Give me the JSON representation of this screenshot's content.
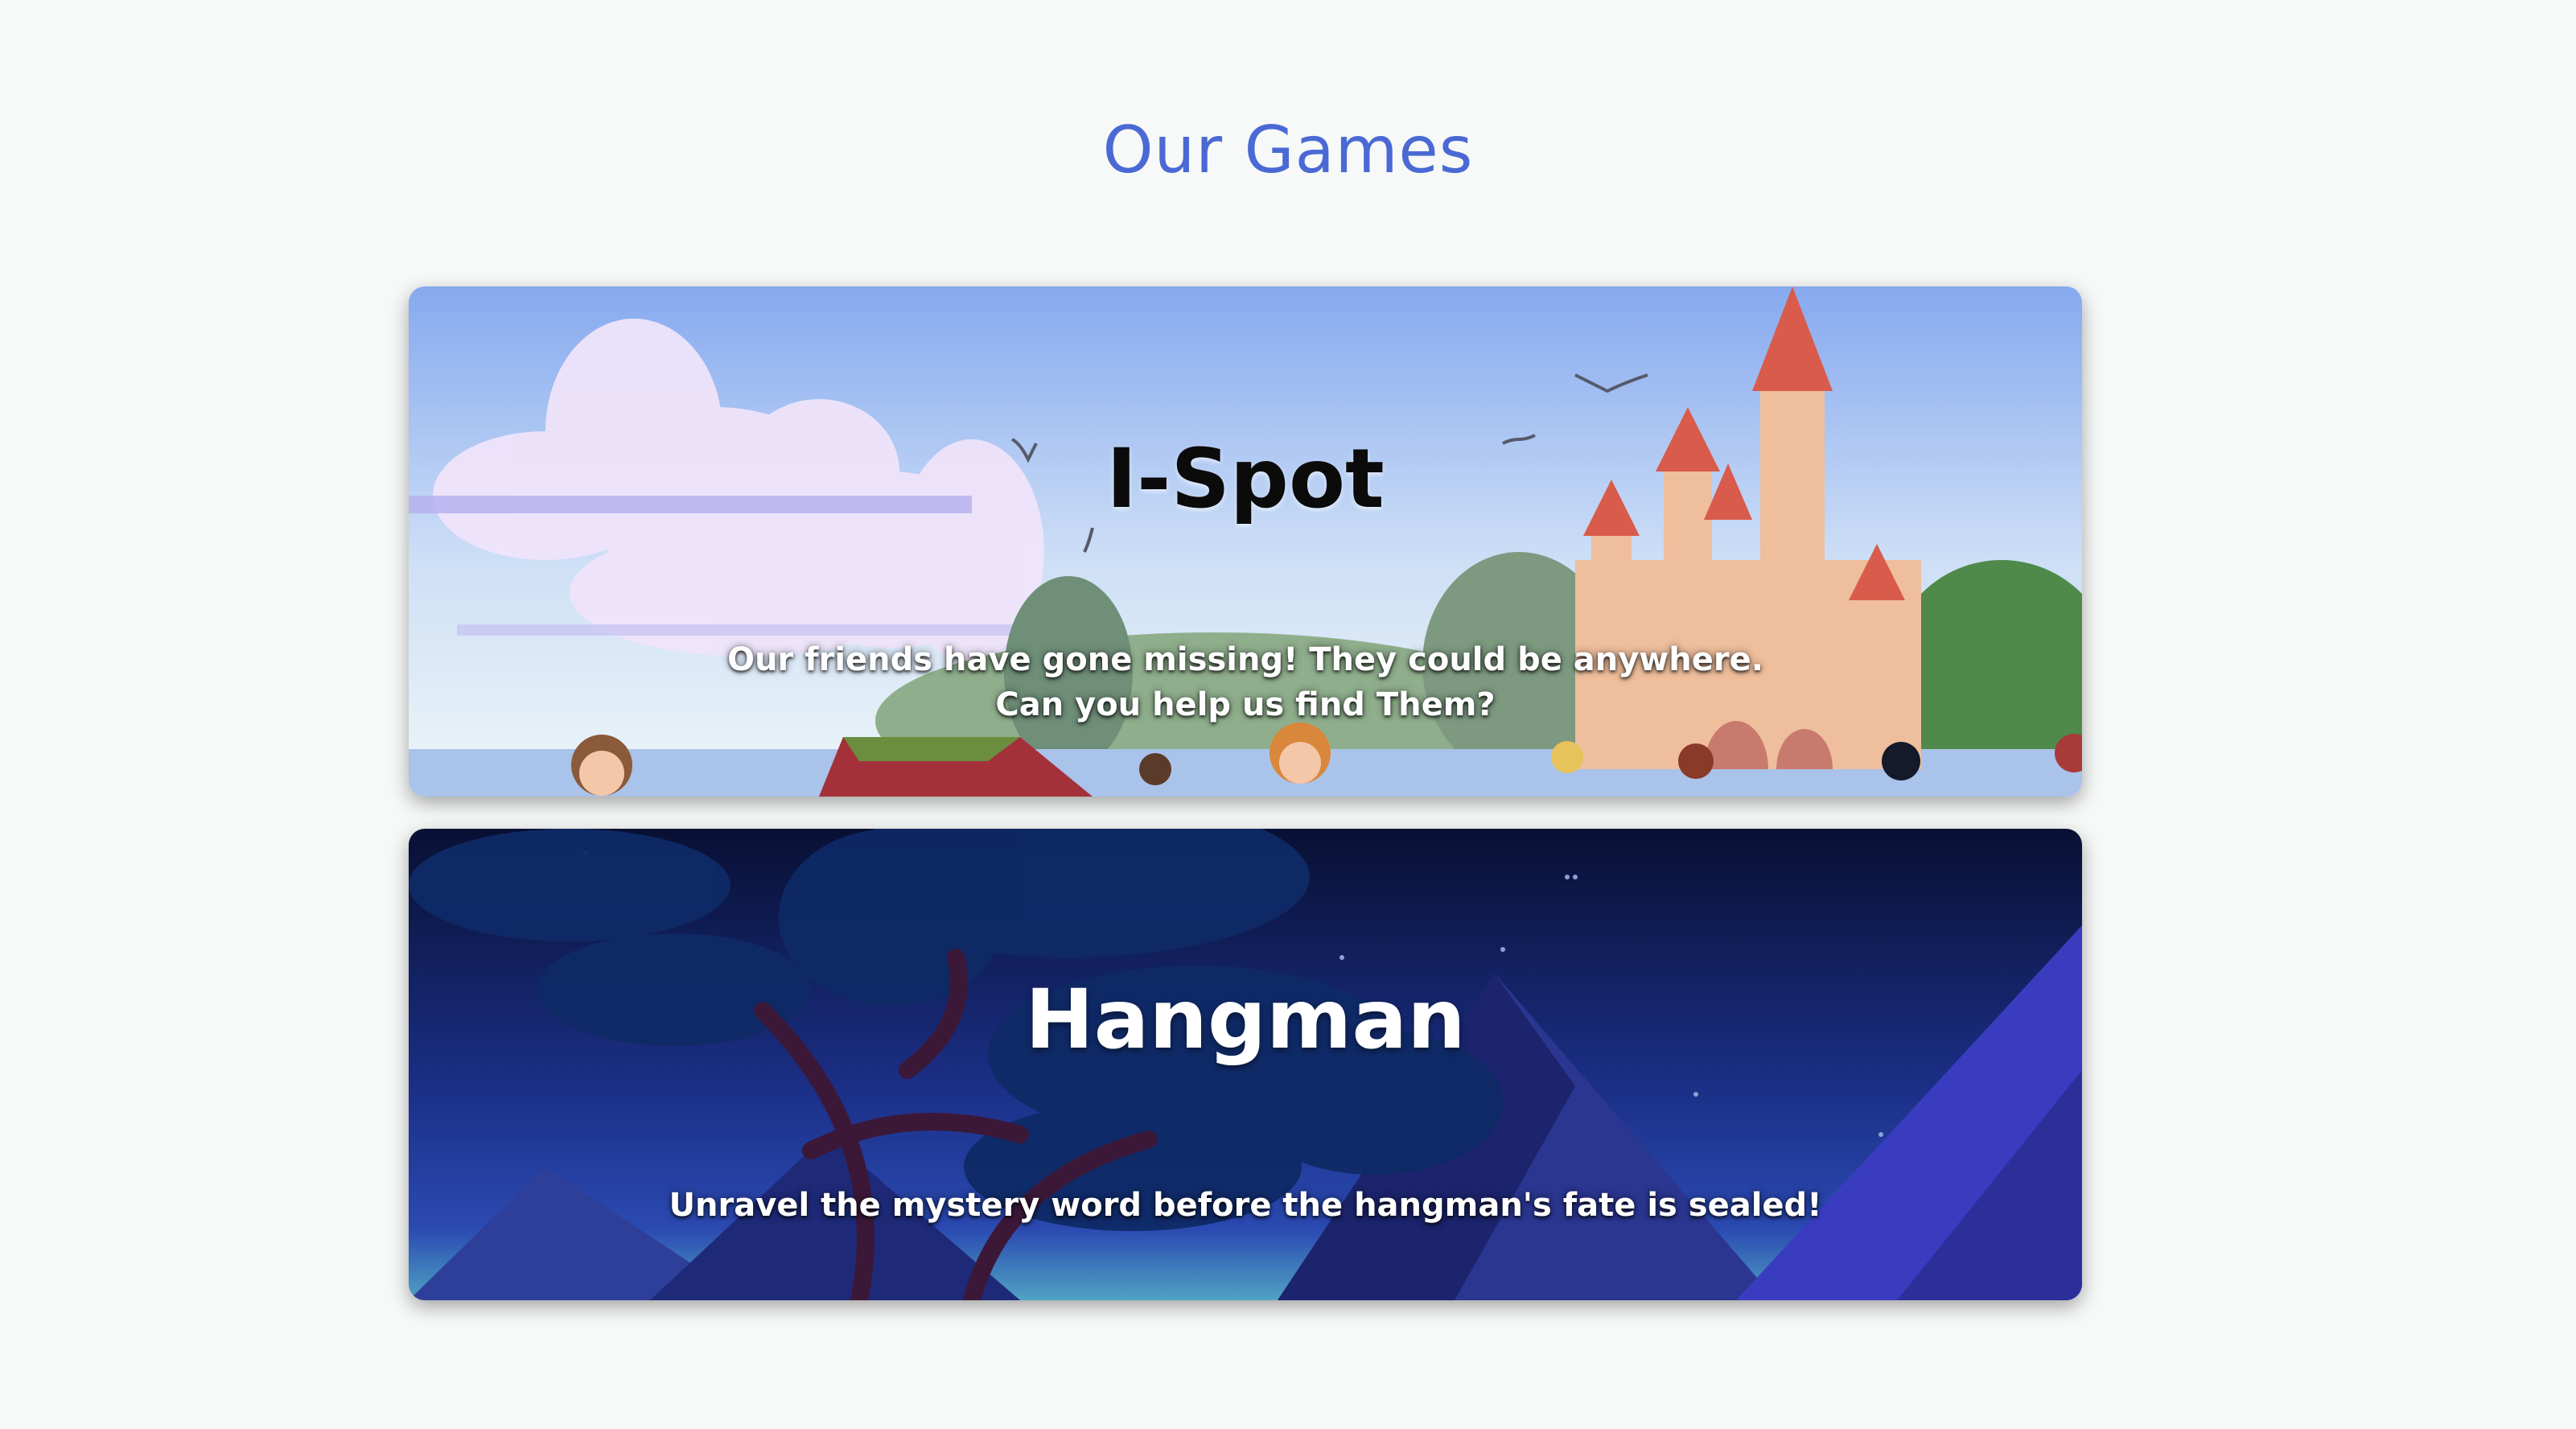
{
  "page": {
    "title": "Our Games"
  },
  "games": [
    {
      "title": "I-Spot",
      "description_line1": "Our friends have gone missing! They could be anywhere.",
      "description_line2": "Can you help us find Them?",
      "background": "castle-landscape-image"
    },
    {
      "title": "Hangman",
      "description_line1": "Unravel the mystery word before the hangman's fate is sealed!",
      "background": "night-mountains-image"
    }
  ],
  "colors": {
    "page_background": "#f7f9f8",
    "title_accent": "#4a69d4",
    "ispot_sky": "#8fb0ee",
    "hangman_sky": "#0b1442"
  }
}
